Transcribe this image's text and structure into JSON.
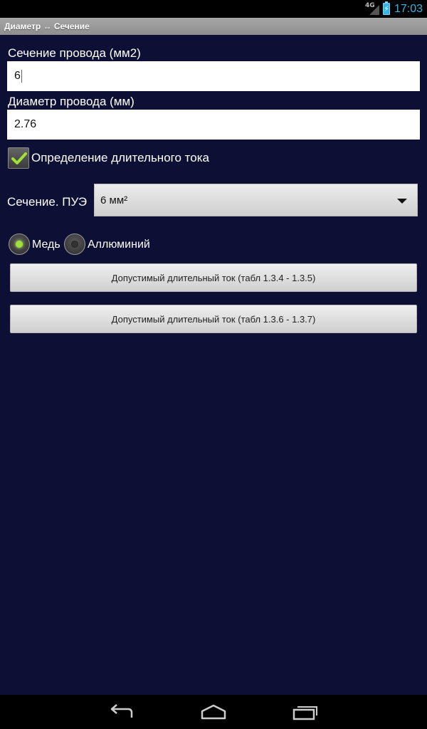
{
  "status_bar": {
    "network": "4G",
    "time": "17:03",
    "icons": [
      "signal-icon",
      "battery-icon"
    ]
  },
  "title_bar": {
    "title": "Диаметр ↔ Сечение"
  },
  "section_field": {
    "label": "Сечение провода (мм2)",
    "value": "6"
  },
  "diameter_field": {
    "label": "Диаметр провода (мм)",
    "value": "2.76"
  },
  "continuous_current": {
    "label": "Определение длительного тока",
    "checked": true
  },
  "pue_section": {
    "label": "Сечение. ПУЭ",
    "selected": "6 мм²"
  },
  "material": {
    "options": [
      {
        "label": "Медь",
        "selected": true
      },
      {
        "label": "Аллюминий",
        "selected": false
      }
    ]
  },
  "buttons": {
    "table_134_135": "Допустимый длительный ток (табл 1.3.4 - 1.3.5)",
    "table_136_137": "Допустимый длительный ток (табл 1.3.6 - 1.3.7)"
  },
  "nav_bar": {
    "icons": [
      "back-icon",
      "home-icon",
      "recent-apps-icon"
    ]
  },
  "colors": {
    "background": "#0d0f35",
    "accent": "#33b5e5",
    "radio_on": "#9fe03a",
    "check": "#9fe03a"
  }
}
